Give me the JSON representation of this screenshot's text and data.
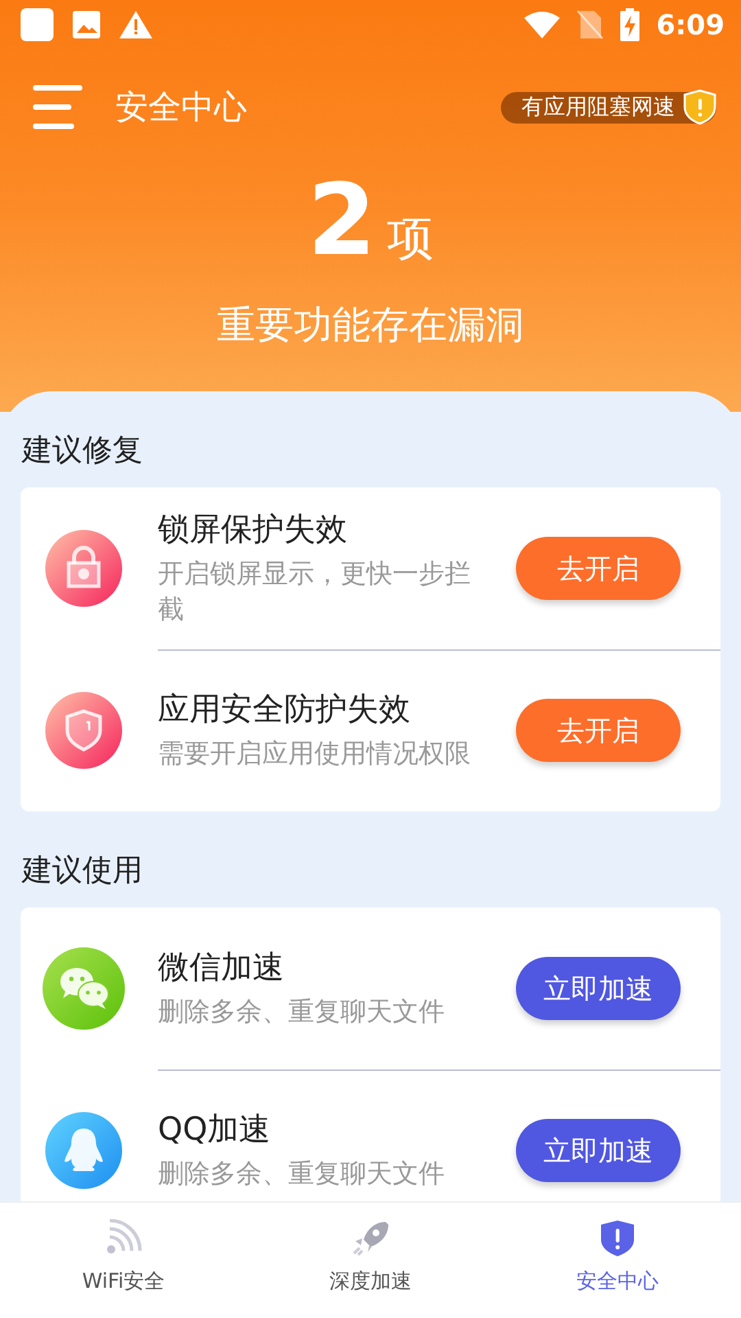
{
  "status_bar": {
    "time": "6:09"
  },
  "header": {
    "title": "安全中心",
    "badge": "有应用阻塞网速"
  },
  "summary": {
    "count": "2",
    "unit": "项",
    "message": "重要功能存在漏洞"
  },
  "sections": [
    {
      "title": "建议修复",
      "kind": "fix",
      "items": [
        {
          "kind": "lock",
          "title": "锁屏保护失效",
          "description": "开启锁屏显示，更快一步拦截",
          "action": "去开启"
        },
        {
          "kind": "shield",
          "title": "应用安全防护失效",
          "description": "需要开启应用使用情况权限",
          "action": "去开启"
        }
      ]
    },
    {
      "title": "建议使用",
      "kind": "boost",
      "items": [
        {
          "kind": "chat",
          "title": "微信加速",
          "description": "删除多余、重复聊天文件",
          "action": "立即加速"
        },
        {
          "kind": "penguin",
          "title": "QQ加速",
          "description": "删除多余、重复聊天文件",
          "action": "立即加速"
        }
      ]
    }
  ],
  "tabs": [
    {
      "kind": "wifi",
      "label": "WiFi安全",
      "selected": false
    },
    {
      "kind": "rocket",
      "label": "深度加速",
      "selected": false
    },
    {
      "kind": "shield",
      "label": "安全中心",
      "selected": true
    }
  ]
}
